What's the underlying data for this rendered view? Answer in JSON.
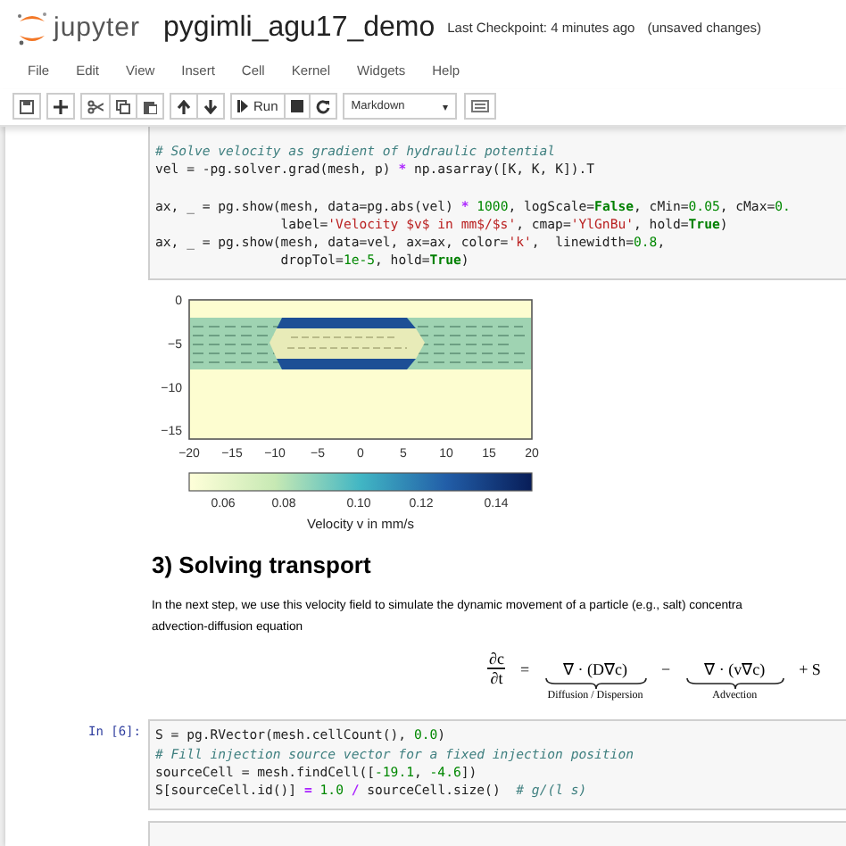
{
  "header": {
    "logo_text": "jupyter",
    "title": "pygimli_agu17_demo",
    "checkpoint": "Last Checkpoint: 4 minutes ago",
    "save_status": "(unsaved changes)"
  },
  "menu": [
    "File",
    "Edit",
    "View",
    "Insert",
    "Cell",
    "Kernel",
    "Widgets",
    "Help"
  ],
  "toolbar": {
    "run_label": "Run",
    "cell_type": "Markdown",
    "caret": "▾"
  },
  "cell1": {
    "lines": [
      {
        "segments": [
          {
            "kind": "comment",
            "text": "# Solve velocity as gradient of hydraulic potential"
          }
        ]
      },
      {
        "segments": [
          {
            "kind": "plain",
            "text": "vel = -pg.solver.grad(mesh, p) "
          },
          {
            "kind": "op",
            "text": "*"
          },
          {
            "kind": "plain",
            "text": " np.asarray([K, K, K]).T"
          }
        ]
      },
      {
        "gap_before": true,
        "segments": [
          {
            "kind": "plain",
            "text": "ax, _ = pg.show(mesh, data=pg.abs(vel) "
          },
          {
            "kind": "op",
            "text": "* "
          },
          {
            "kind": "number",
            "text": "1000"
          },
          {
            "kind": "plain",
            "text": ", logScale="
          },
          {
            "kind": "keyword",
            "text": "False"
          },
          {
            "kind": "plain",
            "text": ", cMin="
          },
          {
            "kind": "number",
            "text": "0.05"
          },
          {
            "kind": "plain",
            "text": ", cMax="
          },
          {
            "kind": "number",
            "text": "0."
          }
        ]
      },
      {
        "segments": [
          {
            "kind": "plain",
            "text": "                label="
          },
          {
            "kind": "string",
            "text": "'Velocity $v$ in mm$/$s'"
          },
          {
            "kind": "plain",
            "text": ", cmap="
          },
          {
            "kind": "string",
            "text": "'YlGnBu'"
          },
          {
            "kind": "plain",
            "text": ", hold="
          },
          {
            "kind": "keyword",
            "text": "True"
          },
          {
            "kind": "plain",
            "text": ")"
          }
        ]
      },
      {
        "segments": [
          {
            "kind": "plain",
            "text": "ax, _ = pg.show(mesh, data=vel, ax=ax, color="
          },
          {
            "kind": "string",
            "text": "'k'"
          },
          {
            "kind": "plain",
            "text": ",  linewidth="
          },
          {
            "kind": "number",
            "text": "0.8"
          },
          {
            "kind": "plain",
            "text": ","
          }
        ]
      },
      {
        "segments": [
          {
            "kind": "plain",
            "text": "                dropTol="
          },
          {
            "kind": "number",
            "text": "1e-5"
          },
          {
            "kind": "plain",
            "text": ", hold="
          },
          {
            "kind": "keyword",
            "text": "True"
          },
          {
            "kind": "plain",
            "text": ")"
          }
        ]
      }
    ]
  },
  "figure": {
    "y_ticks": [
      "0",
      "−5",
      "−10",
      "−15"
    ],
    "x_ticks": [
      "−20",
      "−15",
      "−10",
      "−5",
      "0",
      "5",
      "10",
      "15",
      "20"
    ],
    "colorbar_ticks": [
      "0.06",
      "0.08",
      "0.10",
      "0.12",
      "0.14"
    ],
    "colorbar_label": "Velocity v in mm/s"
  },
  "markdown": {
    "heading": "3) Solving transport",
    "paragraph": "In the next step, we use this velocity field to simulate the dynamic movement of a particle (e.g., salt) concentra\nadvection-diffusion equation",
    "equation": {
      "numerator": "∂c",
      "denominator": "∂t",
      "equals": "=",
      "term_1": "∇ · (D∇c)",
      "term_1_label": "Diffusion / Dispersion",
      "minus": "−",
      "term_2": "∇ · (v∇c)",
      "term_2_label": "Advection",
      "tail": "+ S"
    }
  },
  "cell2": {
    "prompt": "In [6]:",
    "lines": [
      {
        "segments": [
          {
            "kind": "plain",
            "text": "S = pg.RVector(mesh.cellCount(), "
          },
          {
            "kind": "number",
            "text": "0.0"
          },
          {
            "kind": "plain",
            "text": ")"
          }
        ]
      },
      {
        "segments": [
          {
            "kind": "comment",
            "text": "# Fill injection source vector for a fixed injection position"
          }
        ]
      },
      {
        "segments": [
          {
            "kind": "plain",
            "text": "sourceCell = mesh.findCell(["
          },
          {
            "kind": "number",
            "text": "-19.1"
          },
          {
            "kind": "plain",
            "text": ", "
          },
          {
            "kind": "number",
            "text": "-4.6"
          },
          {
            "kind": "plain",
            "text": "])"
          }
        ]
      },
      {
        "segments": [
          {
            "kind": "plain",
            "text": "S[sourceCell.id()] "
          },
          {
            "kind": "op",
            "text": "= "
          },
          {
            "kind": "number",
            "text": "1.0 "
          },
          {
            "kind": "op",
            "text": "/"
          },
          {
            "kind": "plain",
            "text": " sourceCell.size()  "
          },
          {
            "kind": "comment",
            "text": "# g/(l s)"
          }
        ]
      }
    ]
  }
}
